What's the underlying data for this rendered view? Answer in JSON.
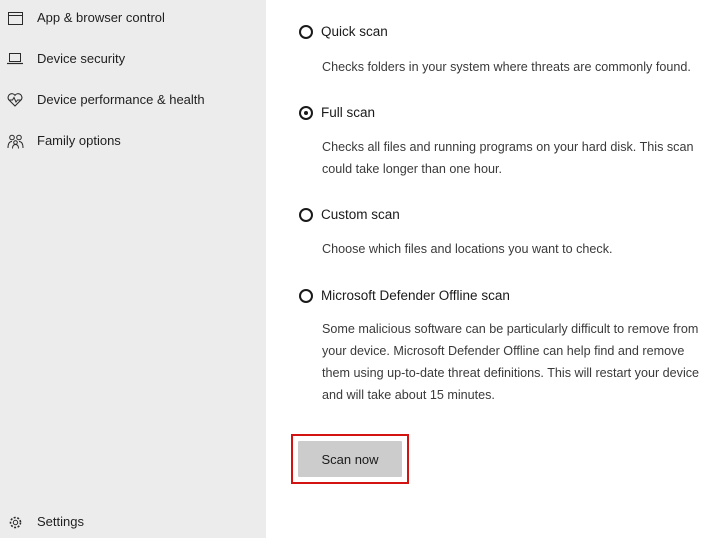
{
  "sidebar": {
    "items": [
      {
        "label": "App & browser control",
        "icon": "browser-window-icon"
      },
      {
        "label": "Device security",
        "icon": "laptop-icon"
      },
      {
        "label": "Device performance & health",
        "icon": "heart-pulse-icon"
      },
      {
        "label": "Family options",
        "icon": "family-icon"
      }
    ],
    "settings": {
      "label": "Settings",
      "icon": "gear-icon"
    }
  },
  "scan_options": [
    {
      "label": "Quick scan",
      "selected": false,
      "description": "Checks folders in your system where threats are commonly found."
    },
    {
      "label": "Full scan",
      "selected": true,
      "description": "Checks all files and running programs on your hard disk. This scan could take longer than one hour."
    },
    {
      "label": "Custom scan",
      "selected": false,
      "description": "Choose which files and locations you want to check."
    },
    {
      "label": "Microsoft Defender Offline scan",
      "selected": false,
      "description": "Some malicious software can be particularly difficult to remove from your device. Microsoft Defender Offline can help find and remove them using up-to-date threat definitions. This will restart your device and will take about 15 minutes."
    }
  ],
  "scan_button": {
    "label": "Scan now"
  },
  "colors": {
    "sidebar_bg": "#ececec",
    "highlight": "#d31212",
    "button_bg": "#cccccc"
  }
}
